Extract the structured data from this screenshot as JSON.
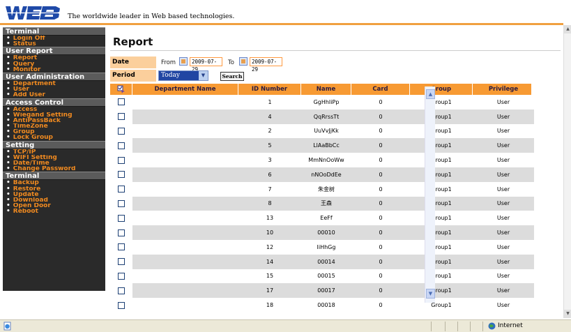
{
  "header": {
    "logo_text": "WEB",
    "tagline": "The worldwide leader in Web based technologies."
  },
  "sidebar": [
    {
      "title": "Terminal",
      "items": [
        "Login Off",
        "Status"
      ]
    },
    {
      "title": "User Report",
      "items": [
        "Report",
        "Query",
        "Monitor"
      ]
    },
    {
      "title": "User Administration",
      "items": [
        "Department",
        "User",
        "Add User"
      ]
    },
    {
      "title": "Access Control",
      "items": [
        "Access",
        "Wiegand Setting",
        "AntiPassBack",
        "TimeZone",
        "Group",
        "Lock Group"
      ]
    },
    {
      "title": "Setting",
      "items": [
        "TCP/IP",
        "WIFI Setting",
        "Date/Time",
        "Change Password"
      ]
    },
    {
      "title": "Terminal",
      "items": [
        "Backup",
        "Restore",
        "Update",
        "Download",
        "Open Door",
        "Reboot"
      ]
    }
  ],
  "report": {
    "title": "Report",
    "date_label": "Date",
    "from_label": "From",
    "to_label": "To",
    "from_value": "2009-07-29",
    "to_value": "2009-07-29",
    "period_label": "Period",
    "period_value": "Today",
    "search_label": "Search"
  },
  "table": {
    "headers": [
      "Department Name",
      "ID Number",
      "Name",
      "Card",
      "Group",
      "Privilege"
    ],
    "rows": [
      {
        "dept": "",
        "id": "1",
        "name": "GgHhIiPp",
        "card": "0",
        "group": "Group1",
        "priv": "User"
      },
      {
        "dept": "",
        "id": "4",
        "name": "QqRrssTt",
        "card": "0",
        "group": "Group1",
        "priv": "User"
      },
      {
        "dept": "",
        "id": "2",
        "name": "UuVvJjKk",
        "card": "0",
        "group": "Group1",
        "priv": "User"
      },
      {
        "dept": "",
        "id": "5",
        "name": "LlAaBbCc",
        "card": "0",
        "group": "Group1",
        "priv": "User"
      },
      {
        "dept": "",
        "id": "3",
        "name": "MmNnOoWw",
        "card": "0",
        "group": "Group1",
        "priv": "User"
      },
      {
        "dept": "",
        "id": "6",
        "name": "nNOoDdEe",
        "card": "0",
        "group": "Group1",
        "priv": "User"
      },
      {
        "dept": "",
        "id": "7",
        "name": "朱金树",
        "card": "0",
        "group": "Group1",
        "priv": "User"
      },
      {
        "dept": "",
        "id": "8",
        "name": "王森",
        "card": "0",
        "group": "Group1",
        "priv": "User"
      },
      {
        "dept": "",
        "id": "13",
        "name": "EeFf",
        "card": "0",
        "group": "Group1",
        "priv": "User"
      },
      {
        "dept": "",
        "id": "10",
        "name": "00010",
        "card": "0",
        "group": "Group1",
        "priv": "User"
      },
      {
        "dept": "",
        "id": "12",
        "name": "IiHhGg",
        "card": "0",
        "group": "Group1",
        "priv": "User"
      },
      {
        "dept": "",
        "id": "14",
        "name": "00014",
        "card": "0",
        "group": "Group1",
        "priv": "User"
      },
      {
        "dept": "",
        "id": "15",
        "name": "00015",
        "card": "0",
        "group": "Group1",
        "priv": "User"
      },
      {
        "dept": "",
        "id": "17",
        "name": "00017",
        "card": "0",
        "group": "Group1",
        "priv": "User"
      },
      {
        "dept": "",
        "id": "18",
        "name": "00018",
        "card": "0",
        "group": "Group1",
        "priv": "User"
      }
    ]
  },
  "statusbar": {
    "zone": "Internet"
  },
  "colors": {
    "accent": "#f79a33",
    "row_alt": "#dcdcdc",
    "sidebar_bg": "#2a2a2a",
    "sidebar_item": "#f08a20",
    "section_bg": "#5b5b5b"
  },
  "icons": {
    "header_select": "select-all-icon",
    "page": "ie-page-icon",
    "globe": "globe-icon"
  }
}
